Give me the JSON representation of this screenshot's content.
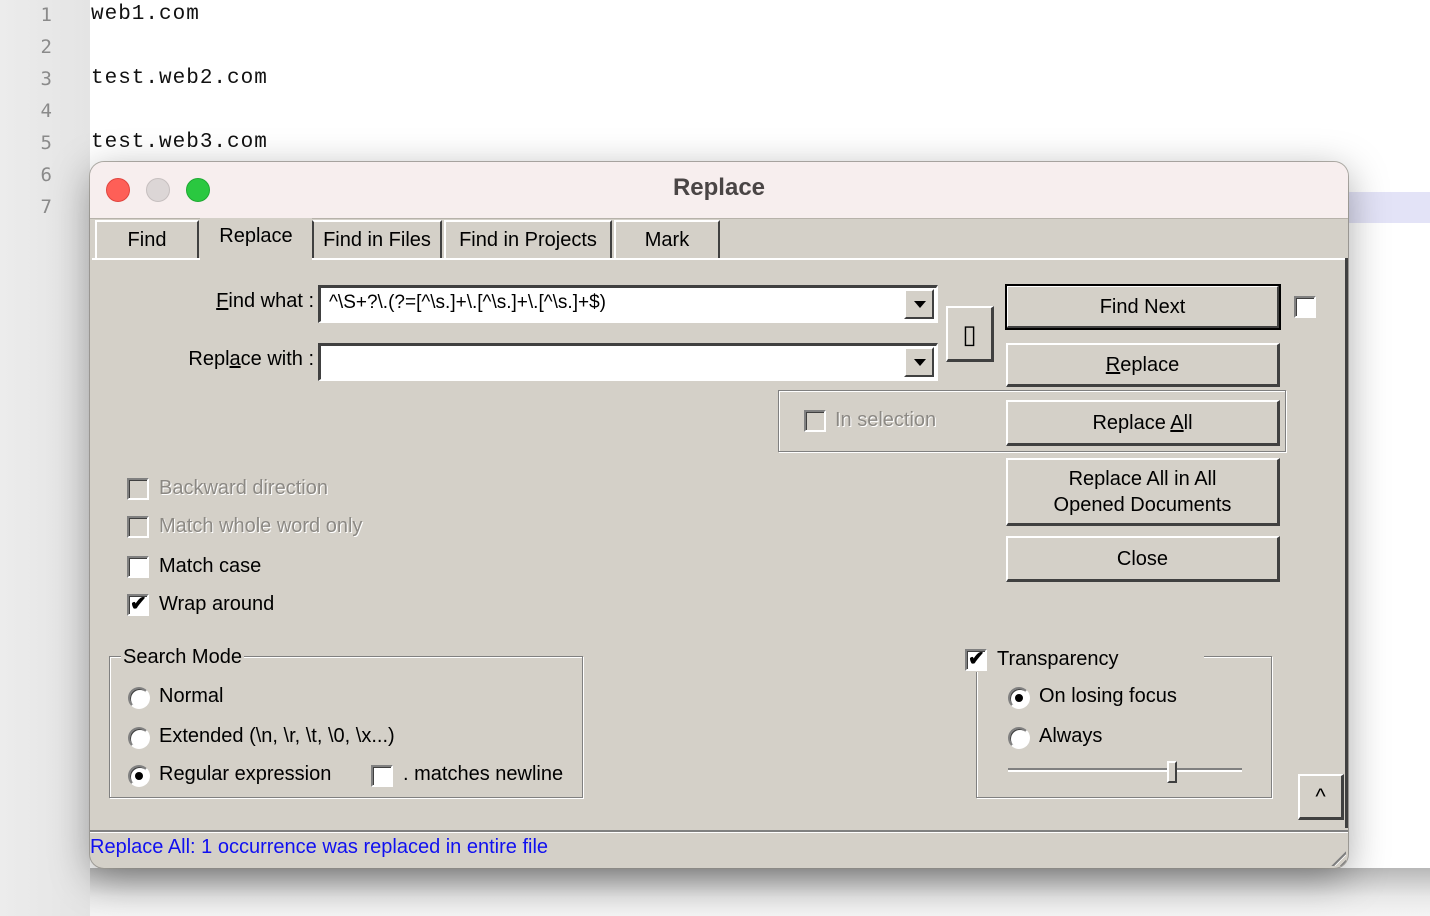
{
  "editor": {
    "line_numbers": [
      "1",
      "2",
      "3",
      "4",
      "5",
      "6",
      "7"
    ],
    "lines": [
      "web1.com",
      "",
      "test.web2.com",
      "",
      "test.web3.com",
      "",
      ""
    ]
  },
  "dialog": {
    "title": "Replace",
    "tabs": [
      {
        "label": "Find",
        "active": false
      },
      {
        "label": "Replace",
        "active": true
      },
      {
        "label": "Find in Files",
        "active": false
      },
      {
        "label": "Find in Projects",
        "active": false
      },
      {
        "label": "Mark",
        "active": false
      }
    ],
    "find_what": {
      "label": "Find what :",
      "value": "^\\S+?\\.(?=[^\\s.]+\\.[^\\s.]+\\.[^\\s.]+$)"
    },
    "replace_with": {
      "label": "Replace with :",
      "value": ""
    },
    "swap_button_glyph": "▯",
    "buttons": {
      "find_next": "Find Next",
      "replace": "Replace",
      "replace_all": "Replace All",
      "replace_all_open_line1": "Replace All in All",
      "replace_all_open_line2": "Opened Documents",
      "close": "Close",
      "collapse": "^"
    },
    "in_selection": {
      "label": "In selection",
      "checked": false,
      "enabled": false
    },
    "options": {
      "backward_direction": {
        "label": "Backward direction",
        "checked": false,
        "enabled": false
      },
      "match_whole_word": {
        "label": "Match whole word only",
        "checked": false,
        "enabled": false
      },
      "match_case": {
        "label": "Match case",
        "checked": false,
        "enabled": true
      },
      "wrap_around": {
        "label": "Wrap around",
        "checked": true,
        "enabled": true
      }
    },
    "search_mode": {
      "title": "Search Mode",
      "normal": "Normal",
      "extended": "Extended (\\n, \\r, \\t, \\0, \\x...)",
      "regex": "Regular expression",
      "selected": "regex",
      "dot_matches_newline": {
        "label": ". matches newline",
        "checked": false
      }
    },
    "transparency": {
      "label": "Transparency",
      "checked": true,
      "on_losing_focus": "On losing focus",
      "always": "Always",
      "selected": "on_losing_focus",
      "slider_percent": 70
    },
    "status": "Replace All: 1 occurrence was replaced in entire file",
    "status_color": "#1010f0"
  }
}
